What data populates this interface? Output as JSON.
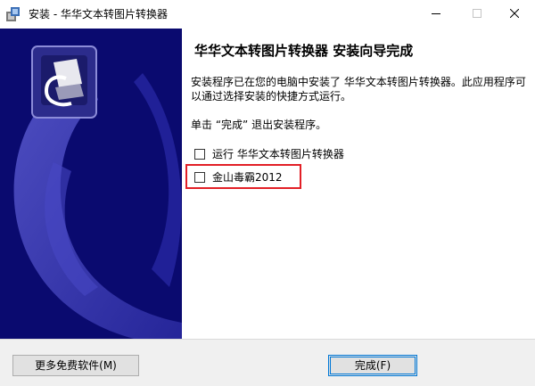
{
  "window": {
    "title": "安装 - 华华文本转图片转换器",
    "app_icon": "installer-app-icon",
    "controls": [
      "minimize-icon",
      "maximize-icon",
      "close-icon"
    ]
  },
  "content": {
    "heading": "华华文本转图片转换器 安装向导完成",
    "description": "安装程序已在您的电脑中安装了 华华文本转图片转换器。此应用程序可以通过选择安装的快捷方式运行。",
    "prompt": "单击 “完成” 退出安装程序。",
    "options": [
      {
        "label": "运行 华华文本转图片转换器",
        "checked": false
      },
      {
        "label": "金山毒霸2012",
        "checked": false
      }
    ],
    "highlight_color": "#e21f26"
  },
  "banner": {
    "color": "#0a0a6f"
  },
  "footer": {
    "more_button": "更多免费软件(M)",
    "finish_button": "完成(F)"
  }
}
